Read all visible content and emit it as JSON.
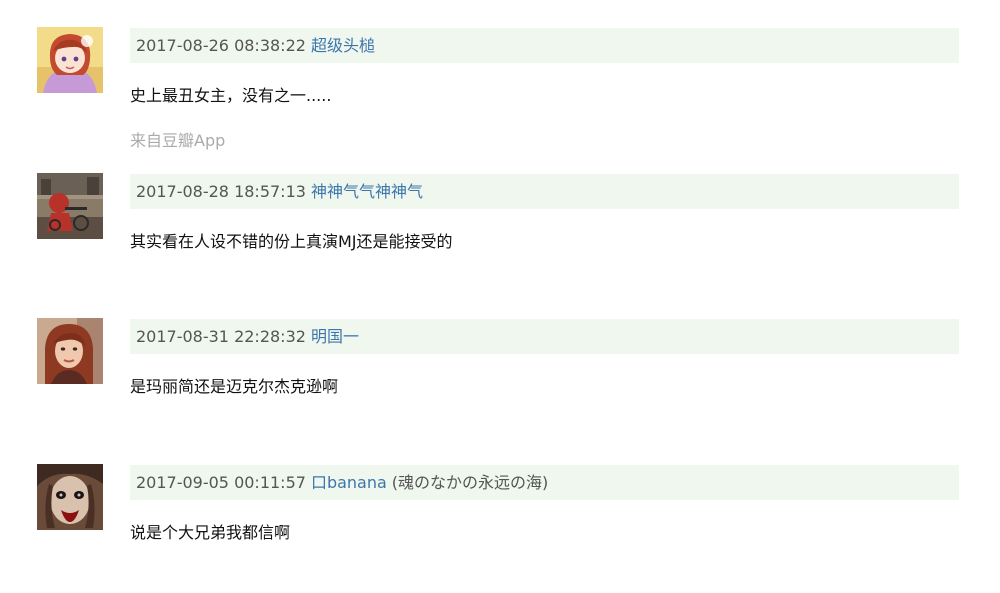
{
  "colors": {
    "meta_bar_background": "#f0f7ee",
    "username_link": "#3c77ac",
    "timestamp": "#555555",
    "comment_text": "#111111",
    "source_text": "#aaaaaa"
  },
  "comments": [
    {
      "avatar": "avatar-icon",
      "time": "2017-08-26 08:38:22",
      "user": "超级头槌",
      "location": "",
      "text": "史上最丑女主，没有之一.....",
      "source": "来自豆瓣App"
    },
    {
      "avatar": "avatar-icon",
      "time": "2017-08-28 18:57:13",
      "user": "神神气气神神气",
      "location": "",
      "text": "其实看在人设不错的份上真演MJ还是能接受的",
      "source": ""
    },
    {
      "avatar": "avatar-icon",
      "time": "2017-08-31 22:28:32",
      "user": "明国一",
      "location": "",
      "text": "是玛丽简还是迈克尔杰克逊啊",
      "source": ""
    },
    {
      "avatar": "avatar-icon",
      "time": "2017-09-05 00:11:57",
      "user": "口banana",
      "location": "(魂のなかの永远の海)",
      "text": "说是个大兄弟我都信啊",
      "source": ""
    }
  ]
}
